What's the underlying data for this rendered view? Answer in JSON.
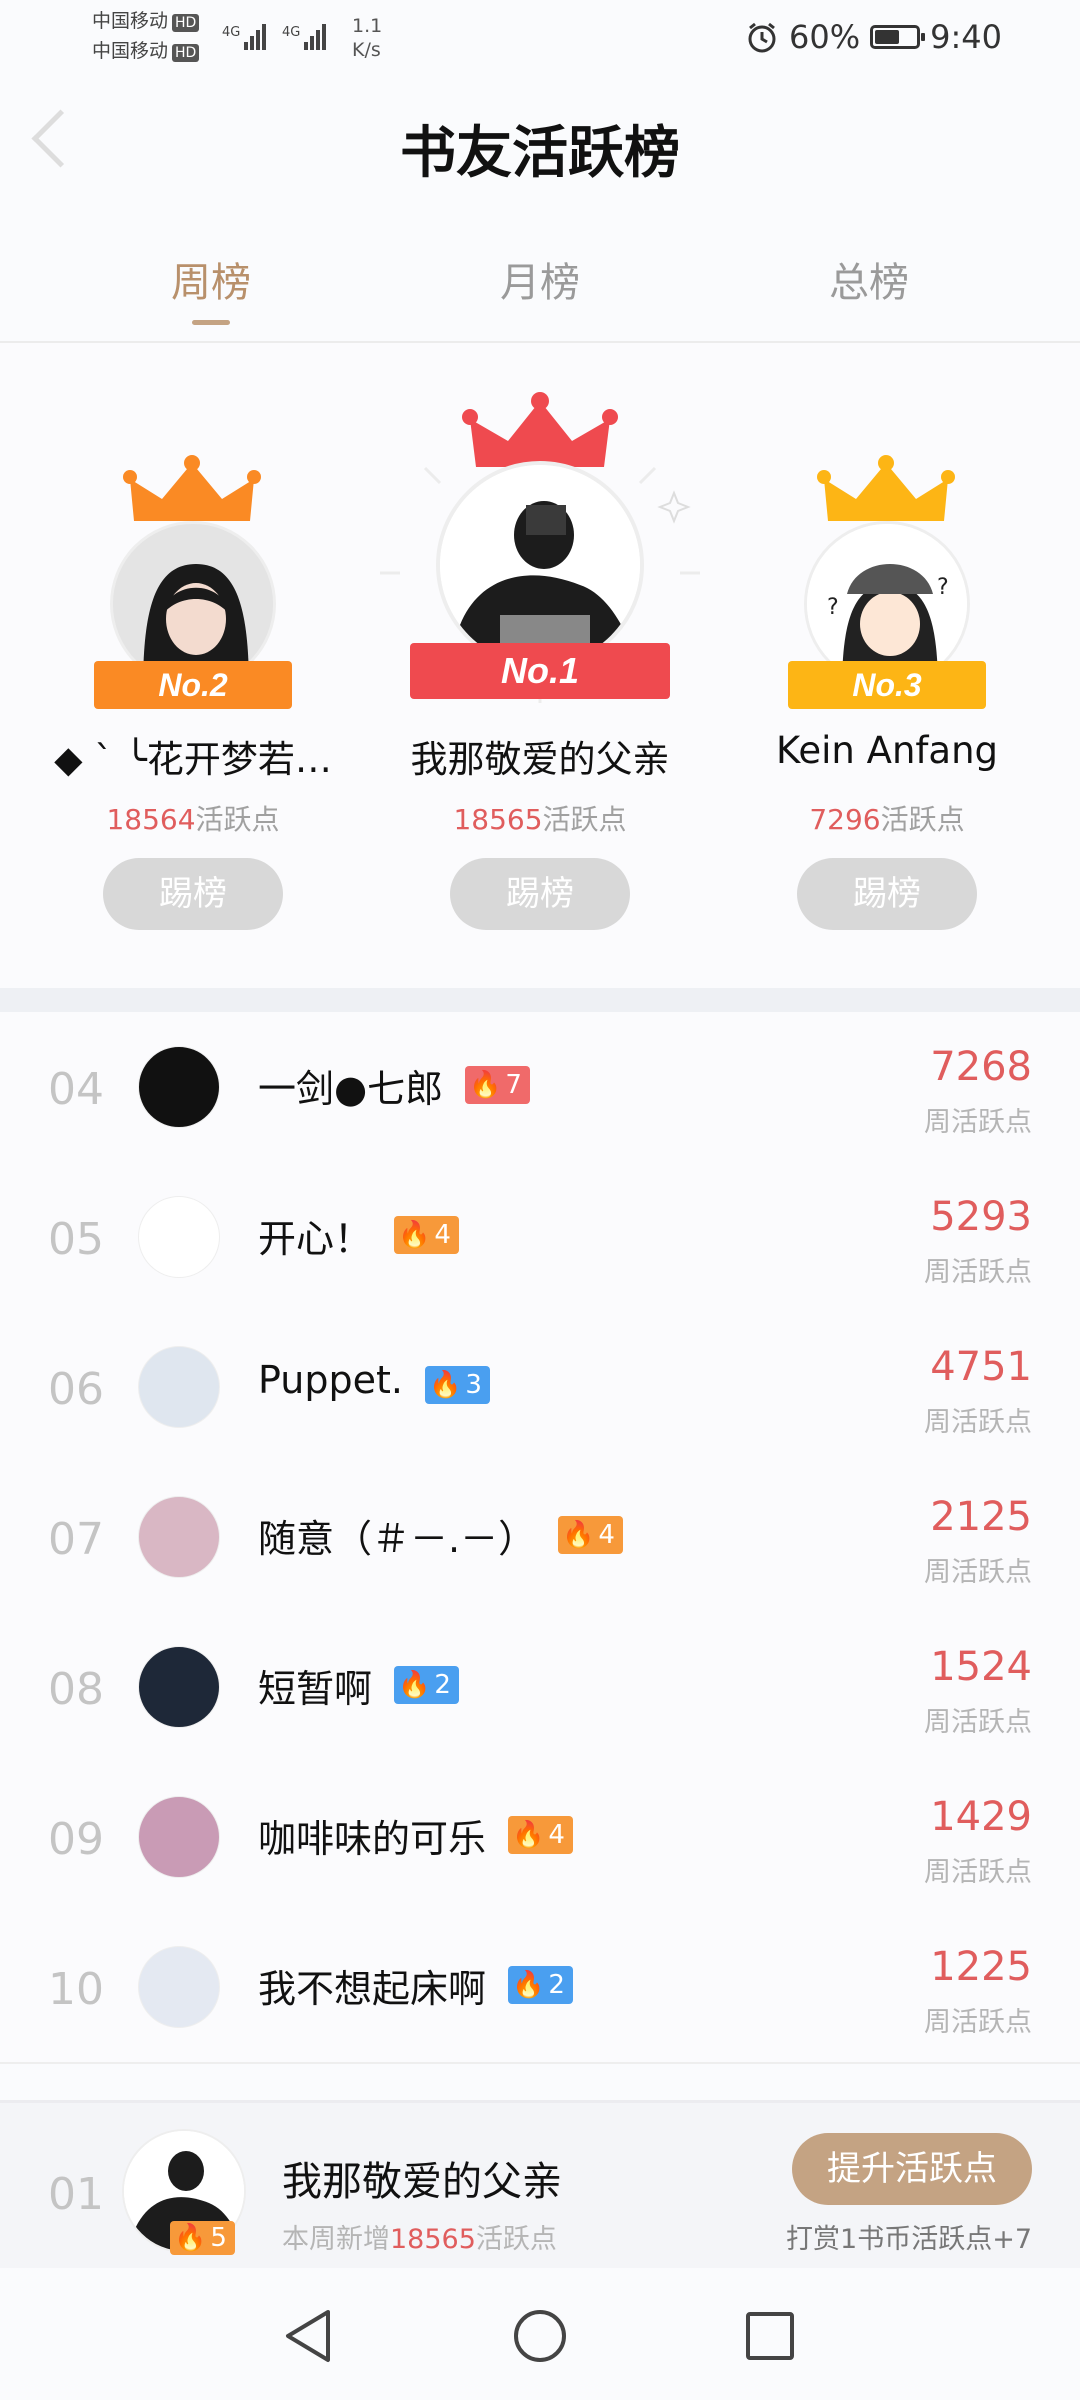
{
  "status_bar": {
    "carrier1": "中国移动",
    "carrier2": "中国移动",
    "hd": "HD",
    "net": "4G",
    "speed_value": "1.1",
    "speed_unit": "K/s",
    "battery": "60%",
    "battery_level": 0.6,
    "time": "9:40"
  },
  "header": {
    "title": "书友活跃榜"
  },
  "tabs": [
    {
      "label": "周榜",
      "active": true
    },
    {
      "label": "月榜",
      "active": false
    },
    {
      "label": "总榜",
      "active": false
    }
  ],
  "podium": {
    "first": {
      "badge": "No.1",
      "name": "我那敬爱的父亲",
      "points": "18565",
      "suffix": "活跃点",
      "kick_label": "踢榜"
    },
    "second": {
      "badge": "No.2",
      "name": "◆ ˋ ╰花开梦若…",
      "points": "18564",
      "suffix": "活跃点",
      "kick_label": "踢榜"
    },
    "third": {
      "badge": "No.3",
      "name": "Kein Anfang",
      "points": "7296",
      "suffix": "活跃点",
      "kick_label": "踢榜"
    }
  },
  "list": [
    {
      "rank": "04",
      "name": "一剑●七郎",
      "level": "7",
      "level_color": "#f06a6a",
      "score": "7268",
      "score_label": "周活跃点"
    },
    {
      "rank": "05",
      "name": "开心！",
      "level": "4",
      "level_color": "#f7993a",
      "score": "5293",
      "score_label": "周活跃点"
    },
    {
      "rank": "06",
      "name": "Puppet.",
      "level": "3",
      "level_color": "#4a9ff0",
      "score": "4751",
      "score_label": "周活跃点"
    },
    {
      "rank": "07",
      "name": "随意（＃－.－）",
      "level": "4",
      "level_color": "#f7993a",
      "score": "2125",
      "score_label": "周活跃点"
    },
    {
      "rank": "08",
      "name": "短暂啊",
      "level": "2",
      "level_color": "#4a9ff0",
      "score": "1524",
      "score_label": "周活跃点"
    },
    {
      "rank": "09",
      "name": "咖啡味的可乐",
      "level": "4",
      "level_color": "#f7993a",
      "score": "1429",
      "score_label": "周活跃点"
    },
    {
      "rank": "10",
      "name": "我不想起床啊",
      "level": "2",
      "level_color": "#4a9ff0",
      "score": "1225",
      "score_label": "周活跃点"
    }
  ],
  "me": {
    "rank": "01",
    "name": "我那敬爱的父亲",
    "level": "5",
    "sub_prefix": "本周新增",
    "sub_points": "18565",
    "sub_suffix": "活跃点",
    "button": "提升活跃点",
    "hint": "打赏1书币活跃点+7"
  },
  "colors": {
    "accent": "#c4a383",
    "score_red": "#e05d5d",
    "gold": "#fdb515",
    "first_red": "#ef4a4f",
    "second_orange": "#fa8a24"
  }
}
